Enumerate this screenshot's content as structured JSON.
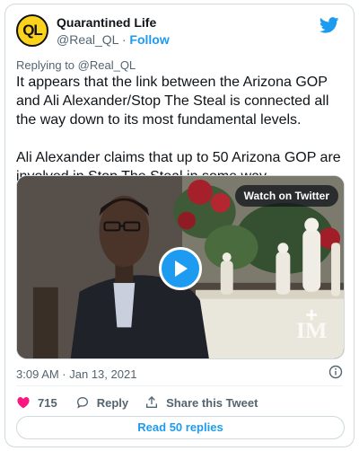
{
  "author": {
    "name": "Quarantined Life",
    "handle": "@Real_QL",
    "separator": " · ",
    "follow_label": "Follow",
    "avatar_text": "QL"
  },
  "replying": {
    "prefix": "Replying to ",
    "mention": "@Real_QL"
  },
  "tweet": {
    "paragraphs": [
      "It appears that the link between the Arizona GOP and Ali Alexander/Stop The Steal is connected all the way down to its most fundamental levels.",
      "Ali Alexander claims that up to 50 Arizona GOP are involved in Stop The Steal in some way."
    ]
  },
  "media": {
    "watch_label": "Watch on Twitter"
  },
  "meta": {
    "timestamp": "3:09 AM · Jan 13, 2021"
  },
  "actions": {
    "like_count": "715",
    "reply_label": "Reply",
    "share_label": "Share this Tweet"
  },
  "footer": {
    "read_replies_label": "Read 50 replies"
  },
  "colors": {
    "accent": "#1d9bf0",
    "like": "#f91880",
    "text": "#0f1419",
    "muted": "#536471",
    "avatar_bg": "#fbd21c"
  },
  "icons": {
    "brand": "twitter-bird-icon",
    "play": "play-icon",
    "info": "info-icon",
    "like": "heart-icon",
    "reply": "reply-bubble-icon",
    "share": "share-icon"
  }
}
